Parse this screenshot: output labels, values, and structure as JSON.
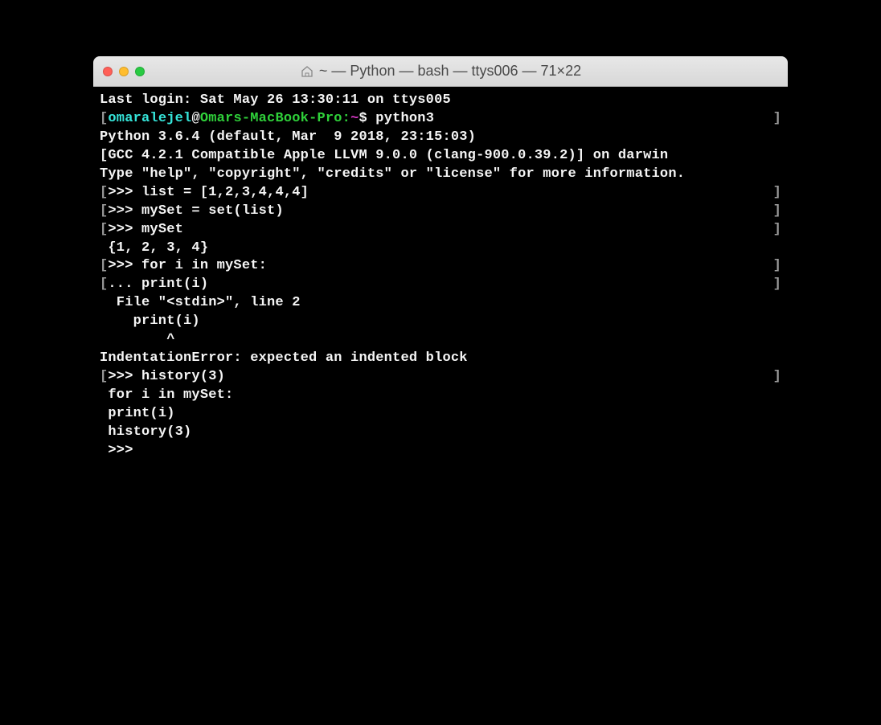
{
  "window": {
    "title": "~ — Python — bash — ttys006 — 71×22"
  },
  "colors": {
    "cyan": "#35e4d9",
    "green": "#2fd13a",
    "magenta": "#d838c7"
  },
  "terminal": {
    "last_login": "Last login: Sat May 26 13:30:11 on ttys005",
    "prompt_user": "omaralejel",
    "prompt_at": "@",
    "prompt_host": "Omars-MacBook-Pro:",
    "prompt_path": "~",
    "prompt_dollar": "$ ",
    "command": "python3",
    "py_version": "Python 3.6.4 (default, Mar  9 2018, 23:15:03) ",
    "py_compiler": "[GCC 4.2.1 Compatible Apple LLVM 9.0.0 (clang-900.0.39.2)] on darwin",
    "py_help": "Type \"help\", \"copyright\", \"credits\" or \"license\" for more information.",
    "in1": "list = [1,2,3,4,4,4]",
    "in2": "mySet = set(list)",
    "in3": "mySet",
    "out3": "{1, 2, 3, 4}",
    "in4": "for i in mySet:",
    "in5": "print(i)",
    "err_file": "  File \"<stdin>\", line 2",
    "err_line": "    print(i)",
    "err_caret": "        ^",
    "err_msg": "IndentationError: expected an indented block",
    "in6": "history(3)",
    "hist1": "for i in mySet:",
    "hist2": "print(i)",
    "hist3": "history(3)",
    "repl_prompt": ">>> ",
    "repl_cont": "... ",
    "lbracket": "[",
    "rbracket": "]",
    "space": " "
  }
}
